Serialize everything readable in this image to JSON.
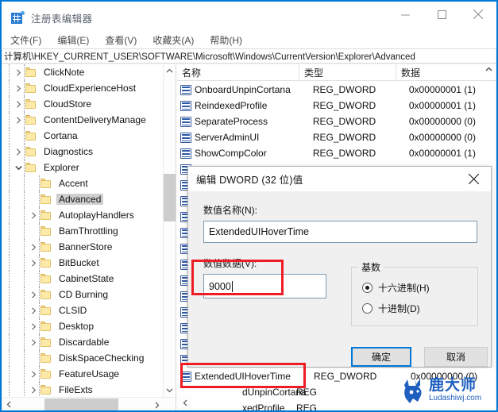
{
  "window": {
    "title": "注册表编辑器",
    "icon": "registry-editor-icon",
    "minimize_label": "−",
    "maximize_label": "□",
    "close_label": "✕"
  },
  "menubar": {
    "items": [
      {
        "label": "文件(F)"
      },
      {
        "label": "编辑(E)"
      },
      {
        "label": "查看(V)"
      },
      {
        "label": "收藏夹(A)"
      },
      {
        "label": "帮助(H)"
      }
    ]
  },
  "address": {
    "path": "计算机\\HKEY_CURRENT_USER\\SOFTWARE\\Microsoft\\Windows\\CurrentVersion\\Explorer\\Advanced"
  },
  "tree": {
    "items": [
      {
        "label": "ClickNote",
        "indent": 1,
        "expander": "collapsed",
        "selected": false
      },
      {
        "label": "CloudExperienceHost",
        "indent": 1,
        "expander": "collapsed",
        "selected": false
      },
      {
        "label": "CloudStore",
        "indent": 1,
        "expander": "collapsed",
        "selected": false
      },
      {
        "label": "ContentDeliveryManage",
        "indent": 1,
        "expander": "collapsed",
        "selected": false
      },
      {
        "label": "Cortana",
        "indent": 1,
        "expander": "none",
        "selected": false
      },
      {
        "label": "Diagnostics",
        "indent": 1,
        "expander": "collapsed",
        "selected": false
      },
      {
        "label": "Explorer",
        "indent": 1,
        "expander": "expanded",
        "selected": false
      },
      {
        "label": "Accent",
        "indent": 2,
        "expander": "none",
        "selected": false
      },
      {
        "label": "Advanced",
        "indent": 2,
        "expander": "none",
        "selected": true
      },
      {
        "label": "AutoplayHandlers",
        "indent": 2,
        "expander": "collapsed",
        "selected": false
      },
      {
        "label": "BamThrottling",
        "indent": 2,
        "expander": "none",
        "selected": false
      },
      {
        "label": "BannerStore",
        "indent": 2,
        "expander": "collapsed",
        "selected": false
      },
      {
        "label": "BitBucket",
        "indent": 2,
        "expander": "collapsed",
        "selected": false
      },
      {
        "label": "CabinetState",
        "indent": 2,
        "expander": "none",
        "selected": false
      },
      {
        "label": "CD Burning",
        "indent": 2,
        "expander": "collapsed",
        "selected": false
      },
      {
        "label": "CLSID",
        "indent": 2,
        "expander": "collapsed",
        "selected": false
      },
      {
        "label": "Desktop",
        "indent": 2,
        "expander": "collapsed",
        "selected": false
      },
      {
        "label": "Discardable",
        "indent": 2,
        "expander": "collapsed",
        "selected": false
      },
      {
        "label": "DiskSpaceChecking",
        "indent": 2,
        "expander": "none",
        "selected": false
      },
      {
        "label": "FeatureUsage",
        "indent": 2,
        "expander": "collapsed",
        "selected": false
      },
      {
        "label": "FileExts",
        "indent": 2,
        "expander": "collapsed",
        "selected": false
      }
    ]
  },
  "value_list": {
    "columns": [
      {
        "label": "名称"
      },
      {
        "label": "类型"
      },
      {
        "label": "数据"
      }
    ],
    "rows": [
      {
        "name": "OnboardUnpinCortana",
        "type": "REG_DWORD",
        "data": "0x00000001 (1)"
      },
      {
        "name": "ReindexedProfile",
        "type": "REG_DWORD",
        "data": "0x00000001 (1)"
      },
      {
        "name": "SeparateProcess",
        "type": "REG_DWORD",
        "data": "0x00000000 (0)"
      },
      {
        "name": "ServerAdminUI",
        "type": "REG_DWORD",
        "data": "0x00000000 (0)"
      },
      {
        "name": "ShowCompColor",
        "type": "REG_DWORD",
        "data": "0x00000001 (1)"
      }
    ],
    "bottom_rows": [
      {
        "name": "ExtendedUIHoverTime",
        "type": "REG_DWORD",
        "data": "0x00000000 (0)"
      }
    ],
    "occluded_rows": [
      {
        "name": "dUnpinCortana",
        "type": "REG"
      },
      {
        "name": "xedProfile",
        "type": "REG"
      }
    ]
  },
  "dialog": {
    "title": "编辑 DWORD (32 位)值",
    "close_label": "✕",
    "value_name_label": "数值名称(N):",
    "value_name": "ExtendedUIHoverTime",
    "value_data_label": "数值数据(V):",
    "value_data": "9000",
    "base_group_label": "基数",
    "base_options": [
      {
        "label": "十六进制(H)",
        "selected": true
      },
      {
        "label": "十进制(D)",
        "selected": false
      }
    ],
    "ok_label": "确定",
    "cancel_label": "取消"
  },
  "watermark": {
    "cn_text": "鹿大师",
    "en_text": "Ludashiwj.com",
    "color": "#1f5fbf"
  },
  "colors": {
    "window_border": "#0078d7",
    "accent": "#0078d7",
    "annotation_red": "#ee1c25",
    "folder_yellow": "#fdeaa8",
    "selection_gray": "#cfcfcf"
  }
}
